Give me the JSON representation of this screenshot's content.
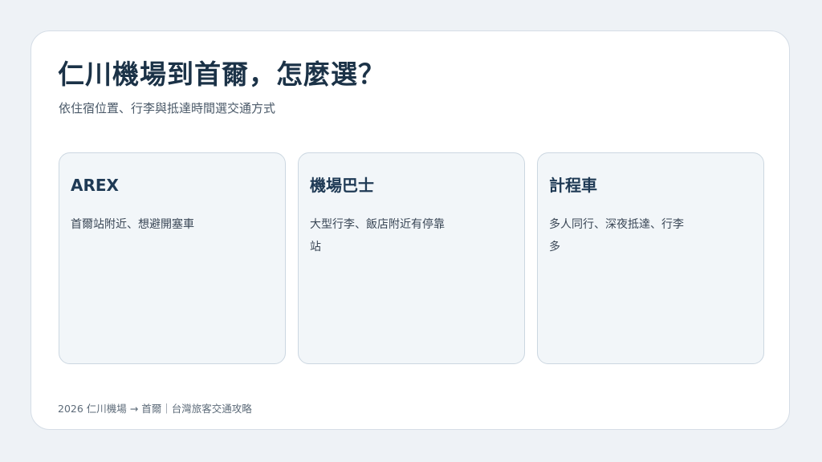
{
  "header": {
    "title": "仁川機場到首爾，怎麼選？",
    "subtitle": "依住宿位置、行李與抵達時間選交通方式"
  },
  "cards": [
    {
      "title": "AREX",
      "description": "首爾站附近、想避開塞車"
    },
    {
      "title": "機場巴士",
      "description": "大型行李、飯店附近有停靠站"
    },
    {
      "title": "計程車",
      "description": "多人同行、深夜抵達、行李多"
    }
  ],
  "footer": {
    "text": "2026 仁川機場 → 首爾｜台灣旅客交通攻略"
  }
}
